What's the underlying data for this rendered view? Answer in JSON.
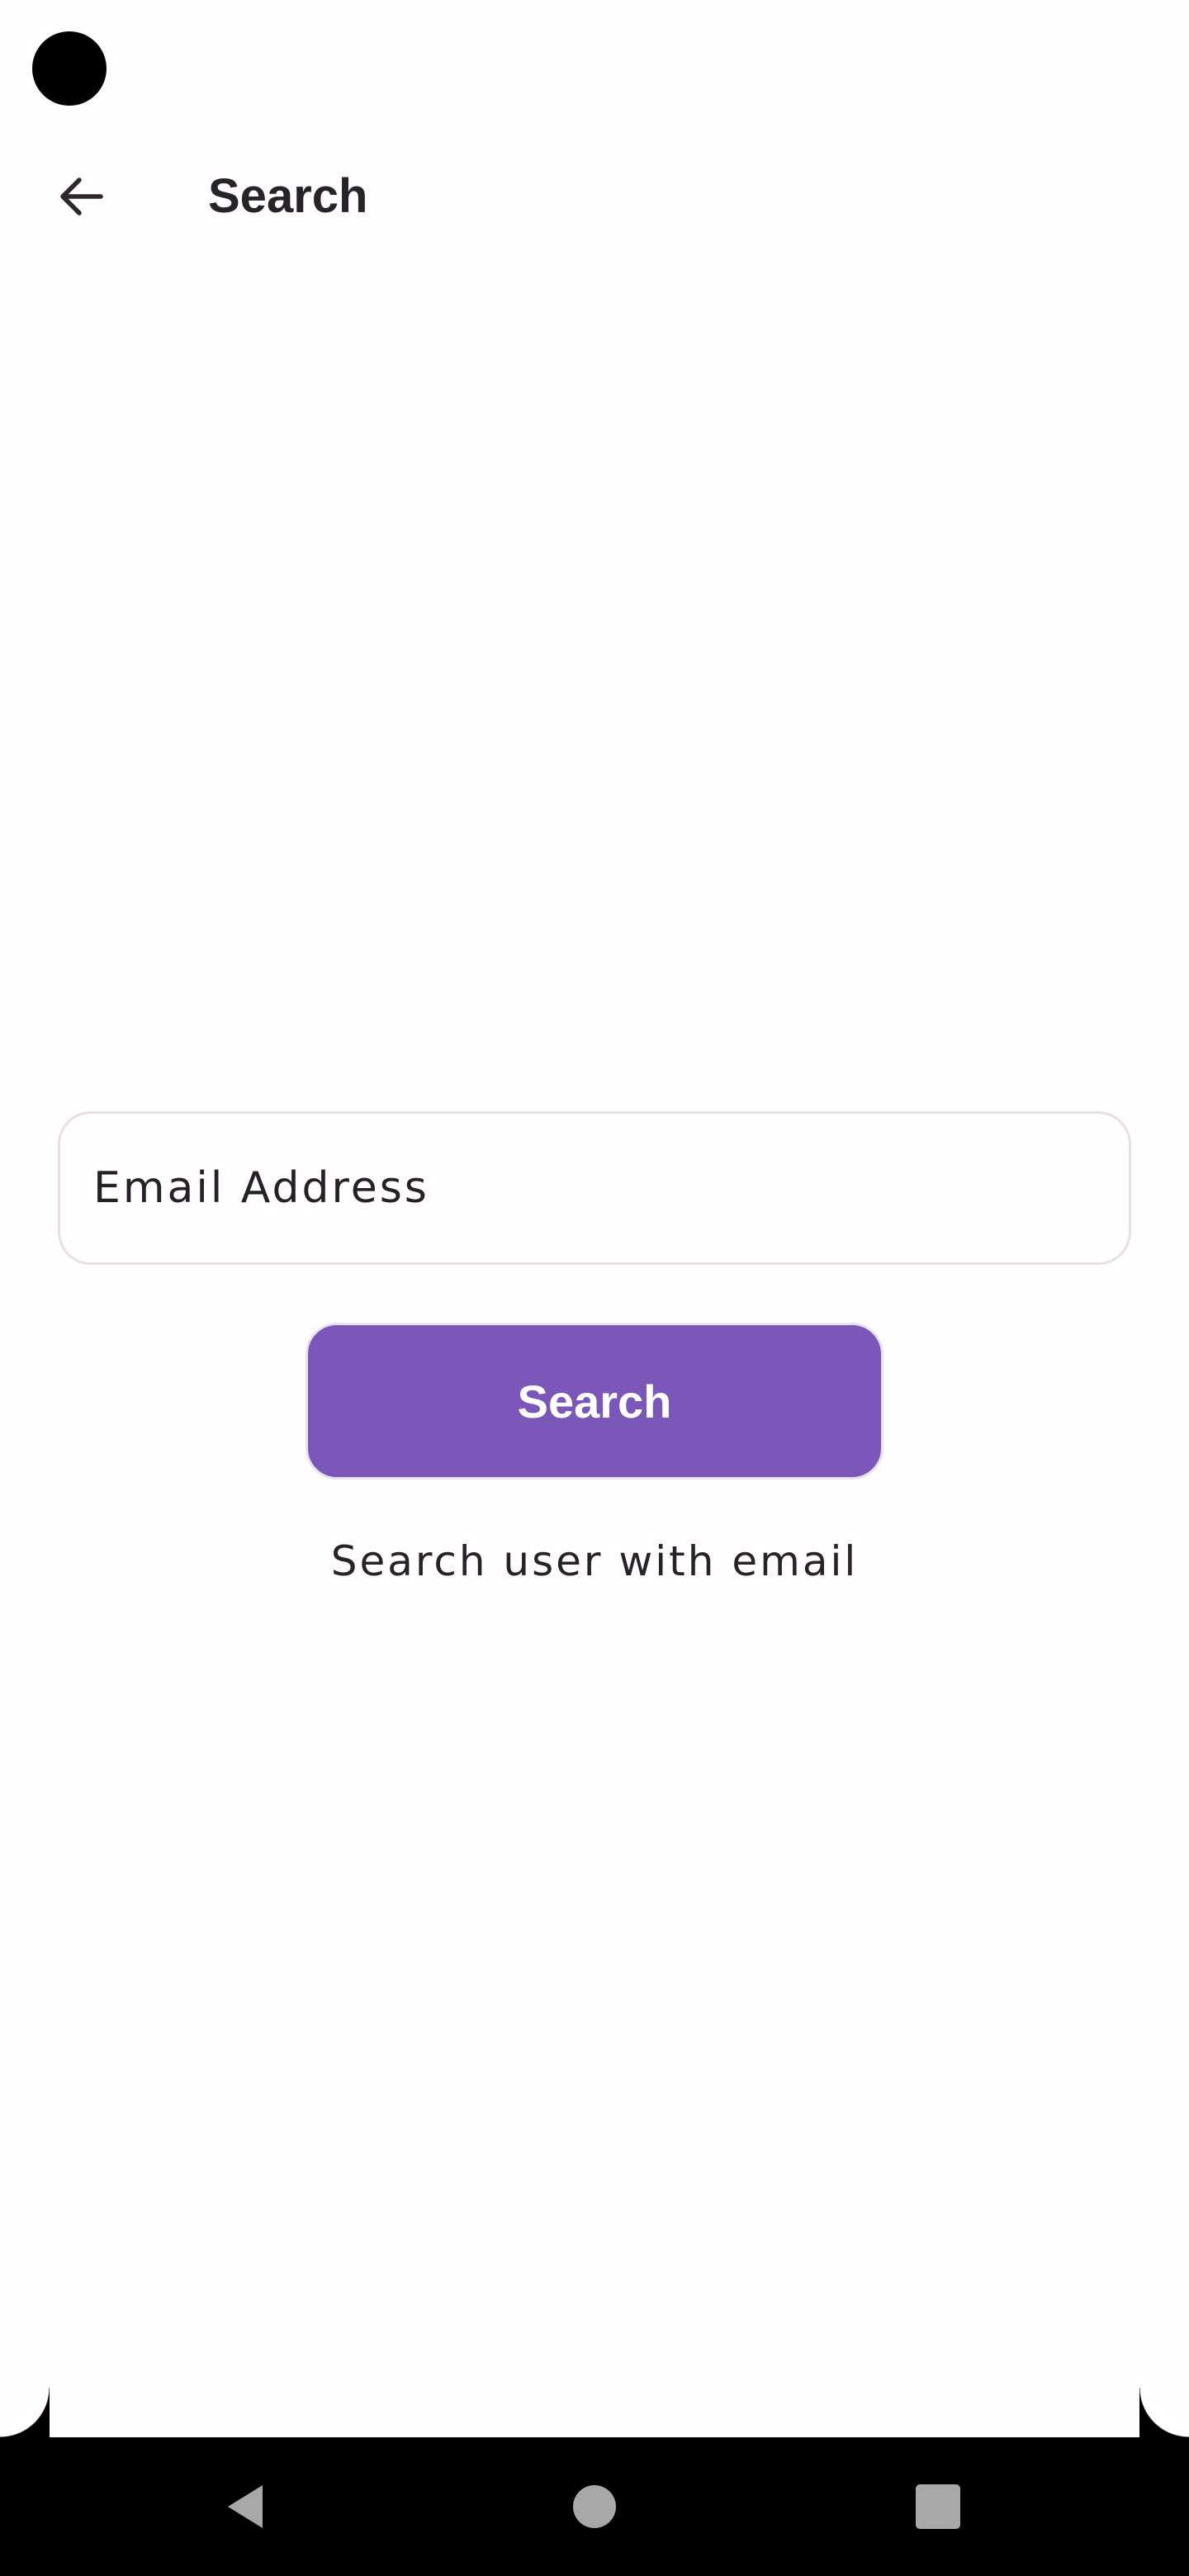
{
  "header": {
    "title": "Search",
    "back_icon": "arrow-left-icon"
  },
  "form": {
    "email_placeholder": "Email Address",
    "email_value": "",
    "search_label": "Search",
    "helper_text": "Search user with email"
  },
  "navigation": {
    "back_icon": "triangle-back-icon",
    "home_icon": "circle-home-icon",
    "recents_icon": "square-recents-icon"
  },
  "colors": {
    "accent": "#7b57ba",
    "background": "#fffdfe",
    "text": "#242226",
    "field_border": "#e3e1e4",
    "nav_background": "#000000",
    "nav_icon": "#a8a8a8"
  }
}
